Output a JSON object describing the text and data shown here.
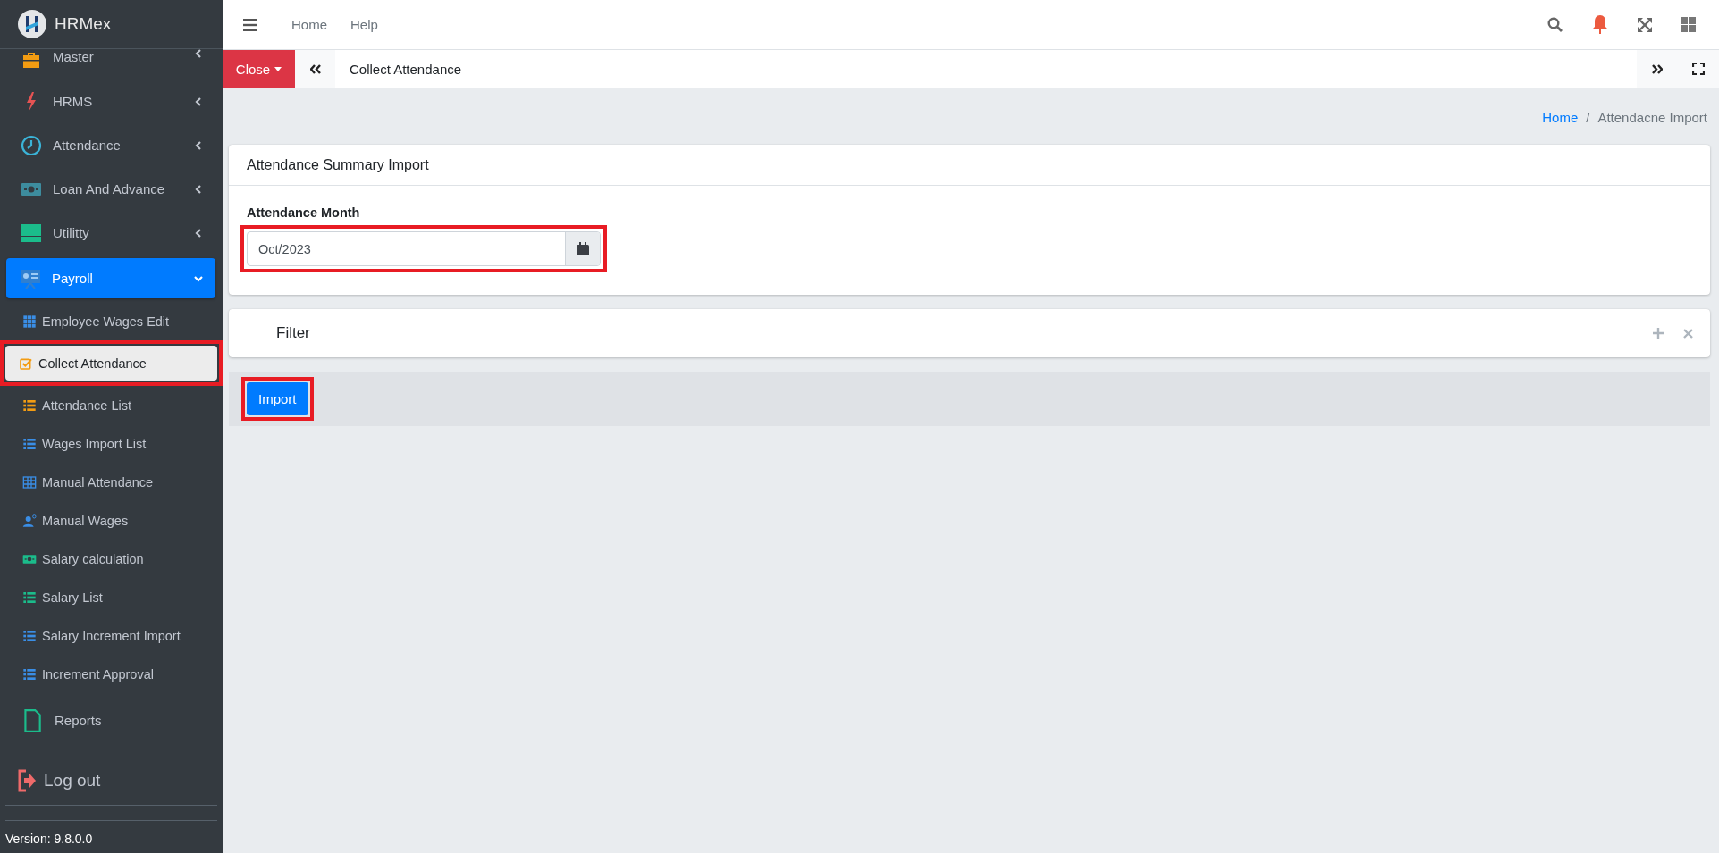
{
  "brand": "**HRM**ex",
  "sidebar": {
    "menu": [
      {
        "label": "Master",
        "kind": "group",
        "expanded": false,
        "selected": false
      },
      {
        "label": "HRMS",
        "kind": "group",
        "expanded": false,
        "selected": false
      },
      {
        "label": "Attendance",
        "kind": "group",
        "expanded": false,
        "selected": false
      },
      {
        "label": "Loan And Advance",
        "kind": "group",
        "expanded": false,
        "selected": false
      },
      {
        "label": "Utilitty",
        "kind": "group",
        "expanded": false,
        "selected": false
      },
      {
        "label": "Payroll",
        "kind": "group",
        "expanded": true,
        "selected": true,
        "children": [
          {
            "label": "Employee Wages Edit",
            "selected": false,
            "highlighted": false
          },
          {
            "label": "Collect Attendance",
            "selected": true,
            "highlighted": true
          },
          {
            "label": "Attendance List",
            "selected": false,
            "highlighted": false
          },
          {
            "label": "Wages Import List",
            "selected": false,
            "highlighted": false
          },
          {
            "label": "Manual Attendance",
            "selected": false,
            "highlighted": false
          },
          {
            "label": "Manual Wages",
            "selected": false,
            "highlighted": false
          },
          {
            "label": "Salary calculation",
            "selected": false,
            "highlighted": false
          },
          {
            "label": "Salary List",
            "selected": false,
            "highlighted": false
          },
          {
            "label": "Salary Increment Import",
            "selected": false,
            "highlighted": false
          },
          {
            "label": "Increment Approval",
            "selected": false,
            "highlighted": false
          }
        ]
      },
      {
        "label": "Reports",
        "kind": "link",
        "selected": false
      }
    ],
    "logout": "Log out",
    "version": "Version: 9.8.0.0"
  },
  "topbar": {
    "links": [
      "Home",
      "Help"
    ]
  },
  "tabbar": {
    "close_label": "Close",
    "tabs": [
      {
        "label": "Collect Attendance",
        "selected": true
      }
    ]
  },
  "breadcrumb": {
    "separator": "/",
    "items": [
      {
        "label": "Home",
        "kind": "link"
      },
      {
        "label": "Attendacne Import",
        "kind": "current"
      }
    ]
  },
  "card": {
    "title": "Attendance Summary Import",
    "field_label": "Attendance Month",
    "field_value": "Oct/2023",
    "field_highlighted": true
  },
  "filter": {
    "title": "Filter"
  },
  "import_button": {
    "label": "Import",
    "highlighted": true
  }
}
